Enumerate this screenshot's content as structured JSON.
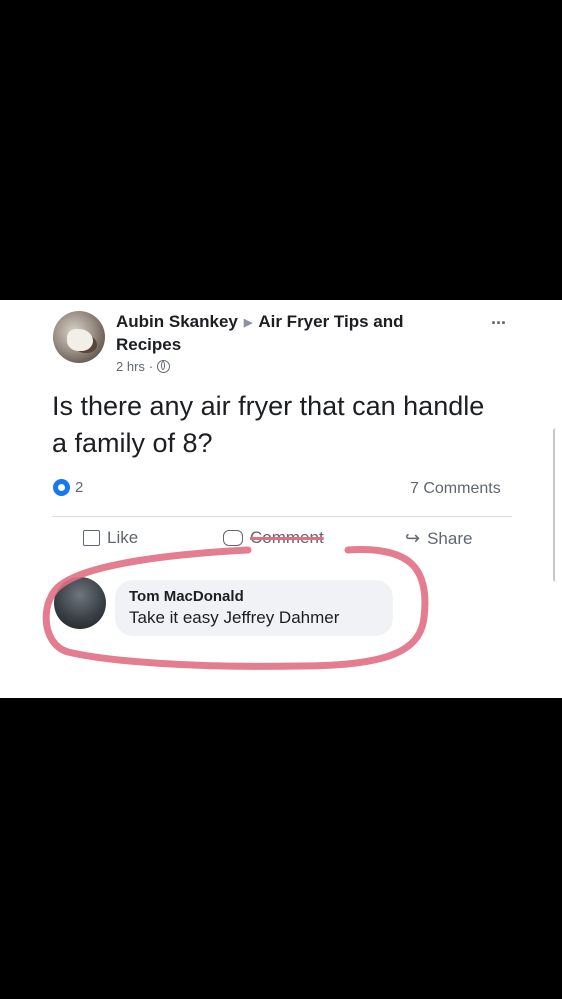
{
  "post": {
    "author": "Aubin Skankey",
    "group": "Air Fryer Tips and Recipes",
    "time": "2 hrs",
    "privacy_icon": "globe-icon",
    "more_label": "...",
    "text": "Is there any air fryer that can handle a family of 8?",
    "reaction_count": "2",
    "comment_count": "7 Comments"
  },
  "actions": {
    "like_label": "Like",
    "comment_label": "Comment",
    "share_label": "Share"
  },
  "comment": {
    "author": "Tom MacDonald",
    "text": "Take it easy Jeffrey Dahmer"
  },
  "colors": {
    "background": "#000000",
    "card": "#ffffff",
    "reaction": "#1877f2",
    "highlight": "#e06f83",
    "comment_bubble": "#f0f2f5"
  }
}
